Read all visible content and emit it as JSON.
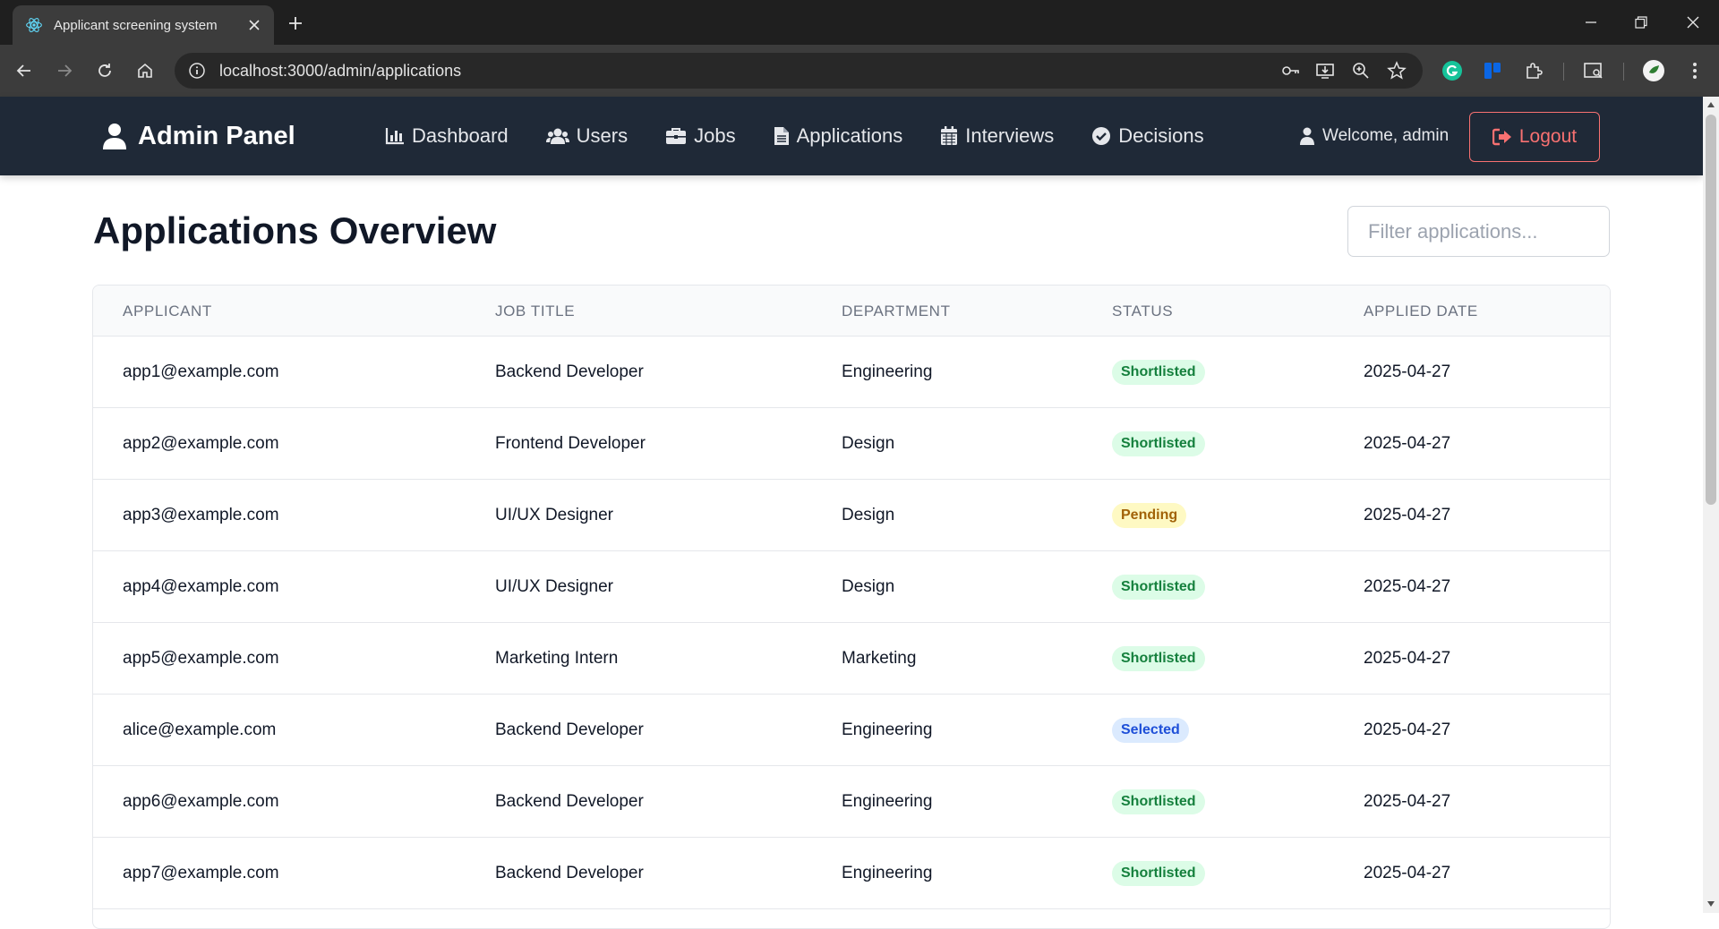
{
  "browser": {
    "tab_title": "Applicant screening system",
    "url": "localhost:3000/admin/applications"
  },
  "navbar": {
    "brand": "Admin Panel",
    "links": [
      {
        "label": "Dashboard",
        "icon": "chart-bar-icon"
      },
      {
        "label": "Users",
        "icon": "users-icon"
      },
      {
        "label": "Jobs",
        "icon": "briefcase-icon"
      },
      {
        "label": "Applications",
        "icon": "file-icon"
      },
      {
        "label": "Interviews",
        "icon": "calendar-icon"
      },
      {
        "label": "Decisions",
        "icon": "check-circle-icon"
      }
    ],
    "welcome": "Welcome, admin",
    "logout": "Logout"
  },
  "page": {
    "title": "Applications Overview",
    "filter_placeholder": "Filter applications..."
  },
  "table": {
    "headers": [
      "APPLICANT",
      "JOB TITLE",
      "DEPARTMENT",
      "STATUS",
      "APPLIED DATE"
    ],
    "rows": [
      {
        "applicant": "app1@example.com",
        "job": "Backend Developer",
        "dept": "Engineering",
        "status": "Shortlisted",
        "date": "2025-04-27"
      },
      {
        "applicant": "app2@example.com",
        "job": "Frontend Developer",
        "dept": "Design",
        "status": "Shortlisted",
        "date": "2025-04-27"
      },
      {
        "applicant": "app3@example.com",
        "job": "UI/UX Designer",
        "dept": "Design",
        "status": "Pending",
        "date": "2025-04-27"
      },
      {
        "applicant": "app4@example.com",
        "job": "UI/UX Designer",
        "dept": "Design",
        "status": "Shortlisted",
        "date": "2025-04-27"
      },
      {
        "applicant": "app5@example.com",
        "job": "Marketing Intern",
        "dept": "Marketing",
        "status": "Shortlisted",
        "date": "2025-04-27"
      },
      {
        "applicant": "alice@example.com",
        "job": "Backend Developer",
        "dept": "Engineering",
        "status": "Selected",
        "date": "2025-04-27"
      },
      {
        "applicant": "app6@example.com",
        "job": "Backend Developer",
        "dept": "Engineering",
        "status": "Shortlisted",
        "date": "2025-04-27"
      },
      {
        "applicant": "app7@example.com",
        "job": "Backend Developer",
        "dept": "Engineering",
        "status": "Shortlisted",
        "date": "2025-04-27"
      }
    ]
  },
  "status_colors": {
    "Shortlisted": {
      "bg": "#dcfce7",
      "fg": "#15803d"
    },
    "Pending": {
      "bg": "#fef9c3",
      "fg": "#a16207"
    },
    "Selected": {
      "bg": "#dbeafe",
      "fg": "#1d4ed8"
    }
  },
  "colors": {
    "navbar_bg": "#1f2937",
    "logout_accent": "#f87171"
  }
}
